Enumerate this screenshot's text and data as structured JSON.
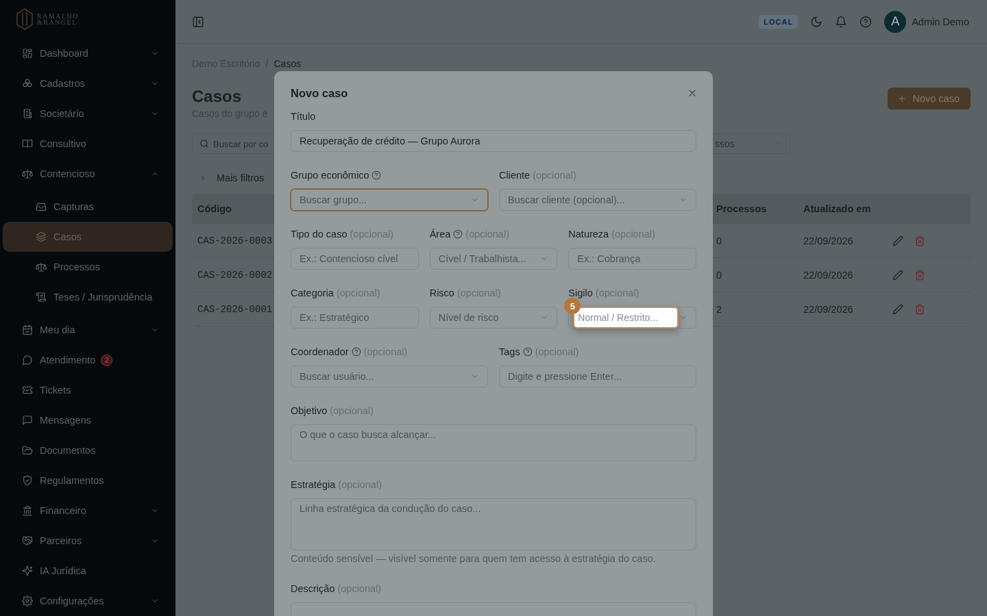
{
  "sidebar": {
    "logo": {
      "line_1": "RAMALHO",
      "line_2": "&RANGEL"
    },
    "items": [
      {
        "label": "Dashboard",
        "expanded": false,
        "selected": false
      },
      {
        "label": "Cadastros",
        "expanded": false,
        "selected": false
      },
      {
        "label": "Societário",
        "expanded": false,
        "selected": false
      },
      {
        "label": "Consultivo",
        "selected": false
      },
      {
        "label": "Contencioso",
        "expanded": true,
        "selected": false,
        "children": [
          {
            "label": "Capturas",
            "selected": false
          },
          {
            "label": "Casos",
            "selected": true
          },
          {
            "label": "Processos",
            "selected": false
          },
          {
            "label": "Teses / Jurisprudência",
            "selected": false
          }
        ]
      },
      {
        "label": "Meu dia",
        "expanded": false,
        "selected": false
      },
      {
        "label": "Atendimento",
        "badge": "2",
        "selected": false
      },
      {
        "label": "Tickets",
        "selected": false
      },
      {
        "label": "Mensagens",
        "selected": false
      },
      {
        "label": "Documentos",
        "selected": false
      },
      {
        "label": "Regulamentos",
        "selected": false
      },
      {
        "label": "Financeiro",
        "expanded": false,
        "selected": false
      },
      {
        "label": "Parceiros",
        "expanded": false,
        "selected": false
      },
      {
        "label": "IA Jurídica",
        "selected": false
      },
      {
        "label": "Configurações",
        "expanded": false,
        "selected": false
      }
    ]
  },
  "topbar": {
    "environment": "LOCAL",
    "user": {
      "initial": "A",
      "name": "Admin Demo"
    }
  },
  "breadcrumb": {
    "items": [
      "Demo Escritório",
      "Casos"
    ],
    "separator": "/"
  },
  "page": {
    "title": "Casos",
    "subtitle": "Casos do grupo e",
    "new_button": "Novo caso",
    "search": {
      "placeholder": "Buscar por co"
    },
    "filter_select": {
      "value": "ssos"
    },
    "more_filters": {
      "label": "Mais filtros",
      "expanded": false
    }
  },
  "table": {
    "columns": [
      "Código",
      "Processos",
      "Atualizado em"
    ],
    "rows": [
      {
        "code": "CAS-2026-0003",
        "processes": "0",
        "updated": "22/09/2026"
      },
      {
        "code": "CAS-2026-0002",
        "processes": "0",
        "updated": "22/09/2026"
      },
      {
        "code": "CAS-2026-0001",
        "processes": "2",
        "updated": "22/09/2026"
      }
    ]
  },
  "modal": {
    "title": "Novo caso",
    "rows": [
      [
        {
          "kind": "input",
          "label": "Título",
          "help": false,
          "value": "Recuperação de crédito — Grupo Aurora"
        }
      ],
      [
        {
          "kind": "select",
          "label": "Grupo econômico",
          "help": true,
          "placeholder": "Buscar grupo...",
          "focused": true
        },
        {
          "kind": "select",
          "label": "Cliente",
          "hint": "(opcional)",
          "help": false,
          "placeholder": "Buscar cliente (opcional)..."
        }
      ],
      [
        {
          "kind": "input",
          "label": "Tipo do caso",
          "hint": "(opcional)",
          "help": false,
          "placeholder": "Ex.: Contencioso cível"
        },
        {
          "kind": "select",
          "label": "Área",
          "hint": "(opcional)",
          "help": true,
          "placeholder": "Cível / Trabalhista..."
        },
        {
          "kind": "input",
          "label": "Natureza",
          "hint": "(opcional)",
          "help": false,
          "placeholder": "Ex.: Cobrança"
        }
      ],
      [
        {
          "kind": "input",
          "label": "Categoria",
          "hint": "(opcional)",
          "help": false,
          "placeholder": "Ex.: Estratégico"
        },
        {
          "kind": "select",
          "label": "Risco",
          "hint": "(opcional)",
          "help": false,
          "placeholder": "Nível de risco"
        },
        {
          "kind": "select",
          "label": "Sigilo",
          "hint": "(opcional)",
          "help": false,
          "placeholder": "Normal / Restrito...",
          "highlighted": true,
          "tour_step": "5"
        }
      ],
      [
        {
          "kind": "select",
          "label": "Coordenador",
          "hint": "(opcional)",
          "help": true,
          "placeholder": "Buscar usuário..."
        },
        {
          "kind": "input",
          "label": "Tags",
          "hint": "(opcional)",
          "help": true,
          "placeholder": "Digite e pressione Enter..."
        }
      ],
      [
        {
          "kind": "textarea",
          "label": "Objetivo",
          "hint": "(opcional)",
          "help": false,
          "placeholder": "O que o caso busca alcançar..."
        }
      ],
      [
        {
          "kind": "textarea",
          "label": "Estratégia",
          "hint": "(opcional)",
          "help": false,
          "placeholder": "Linha estratégica da condução do caso...",
          "note": "Conteúdo sensível — visível somente para quem tem acesso à estratégia do caso."
        }
      ],
      [
        {
          "kind": "textarea",
          "label": "Descrição",
          "hint": "(opcional)",
          "help": false
        }
      ]
    ]
  }
}
